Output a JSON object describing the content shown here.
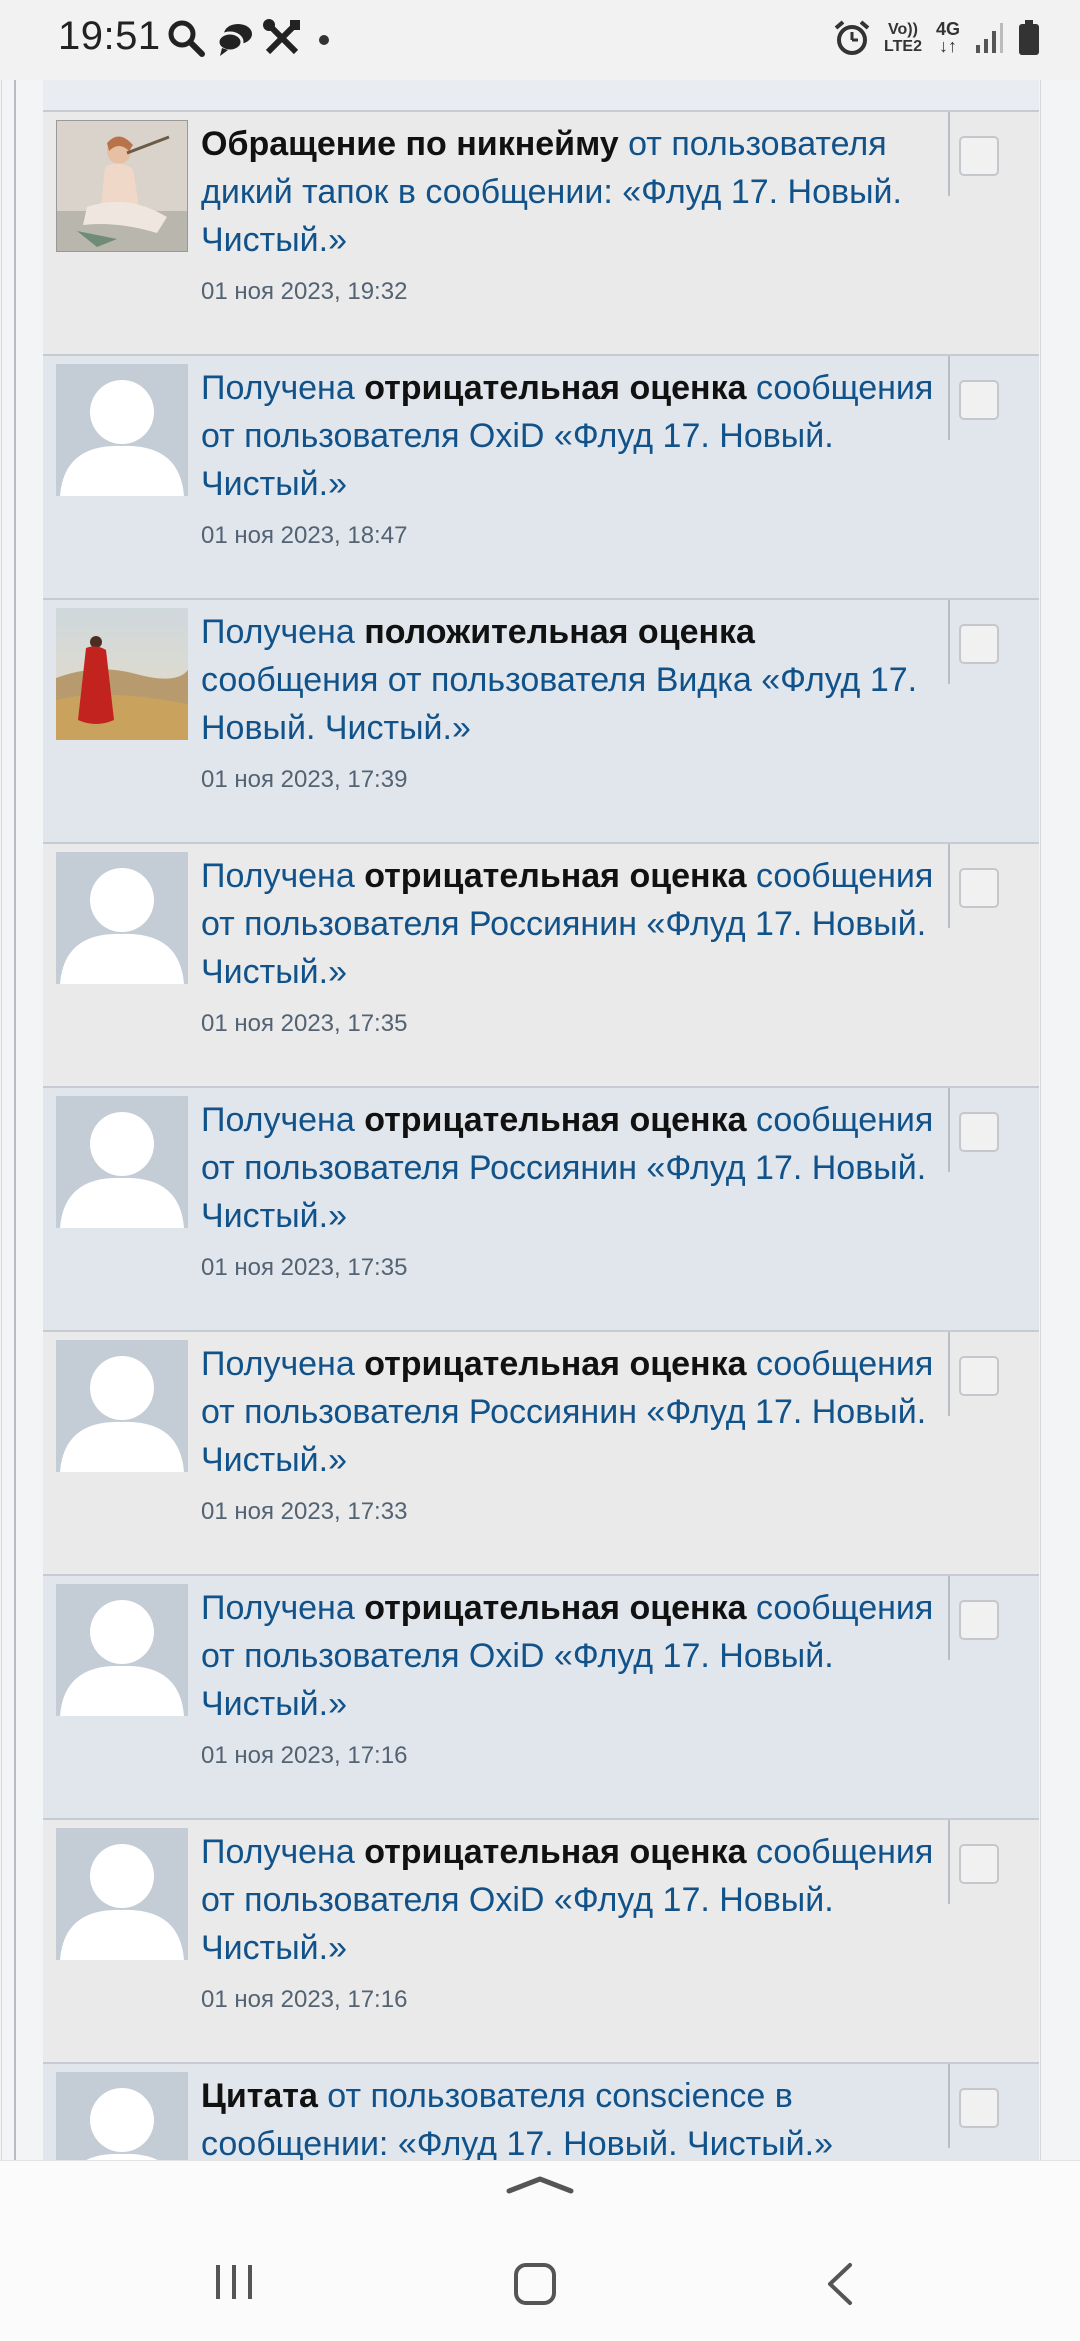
{
  "status_bar": {
    "time": "19:51",
    "left_icons": [
      "search-icon",
      "chat-icon",
      "tools-icon",
      "dot-icon"
    ],
    "network_line1": "Vo))",
    "network_line2": "LTE2",
    "network_type": "4G",
    "right_icons": [
      "alarm-icon",
      "signal-icon",
      "battery-icon"
    ]
  },
  "notifications": [
    {
      "avatar": "woman-flute-painting",
      "prefix": "",
      "bold": "Обращение по никнейму",
      "rest": " от пользователя дикий тапок в сообщении: «Флуд 17. Новый. Чистый.»",
      "time": "01 ноя 2023, 19:32",
      "checked": false
    },
    {
      "avatar": "default",
      "prefix": "Получена ",
      "bold": "отрицательная оценка",
      "rest": " сообщения от пользователя OxiD «Флуд 17. Новый. Чистый.»",
      "time": "01 ноя 2023, 18:47",
      "checked": false
    },
    {
      "avatar": "red-dress-landscape",
      "prefix": "Получена ",
      "bold": "положительная оценка",
      "rest": " сообщения от пользователя Видка «Флуд 17. Новый. Чистый.»",
      "time": "01 ноя 2023, 17:39",
      "checked": false
    },
    {
      "avatar": "default",
      "prefix": "Получена ",
      "bold": "отрицательная оценка",
      "rest": " сообщения от пользователя Россиянин «Флуд 17. Новый. Чистый.»",
      "time": "01 ноя 2023, 17:35",
      "checked": false
    },
    {
      "avatar": "default",
      "prefix": "Получена ",
      "bold": "отрицательная оценка",
      "rest": " сообщения от пользователя Россиянин «Флуд 17. Новый. Чистый.»",
      "time": "01 ноя 2023, 17:35",
      "checked": false
    },
    {
      "avatar": "default",
      "prefix": "Получена ",
      "bold": "отрицательная оценка",
      "rest": " сообщения от пользователя Россиянин «Флуд 17. Новый. Чистый.»",
      "time": "01 ноя 2023, 17:33",
      "checked": false
    },
    {
      "avatar": "default",
      "prefix": "Получена ",
      "bold": "отрицательная оценка",
      "rest": " сообщения от пользователя OxiD «Флуд 17. Новый. Чистый.»",
      "time": "01 ноя 2023, 17:16",
      "checked": false
    },
    {
      "avatar": "default",
      "prefix": "Получена ",
      "bold": "отрицательная оценка",
      "rest": " сообщения от пользователя OxiD «Флуд 17. Новый. Чистый.»",
      "time": "01 ноя 2023, 17:16",
      "checked": false
    },
    {
      "avatar": "default",
      "prefix": "",
      "bold": "Цитата",
      "rest": " от пользователя conscience в сообщении: «Флуд 17. Новый. Чистый.»",
      "time": "",
      "checked": false
    }
  ],
  "nav_bar": {
    "icons": [
      "expand-up-icon",
      "recent-apps-icon",
      "home-icon",
      "back-icon"
    ]
  },
  "colors": {
    "link": "#105289",
    "row_light": "#eaeaea",
    "row_blue": "#e1e6ec",
    "avatar_default": "#c4ccd6"
  }
}
